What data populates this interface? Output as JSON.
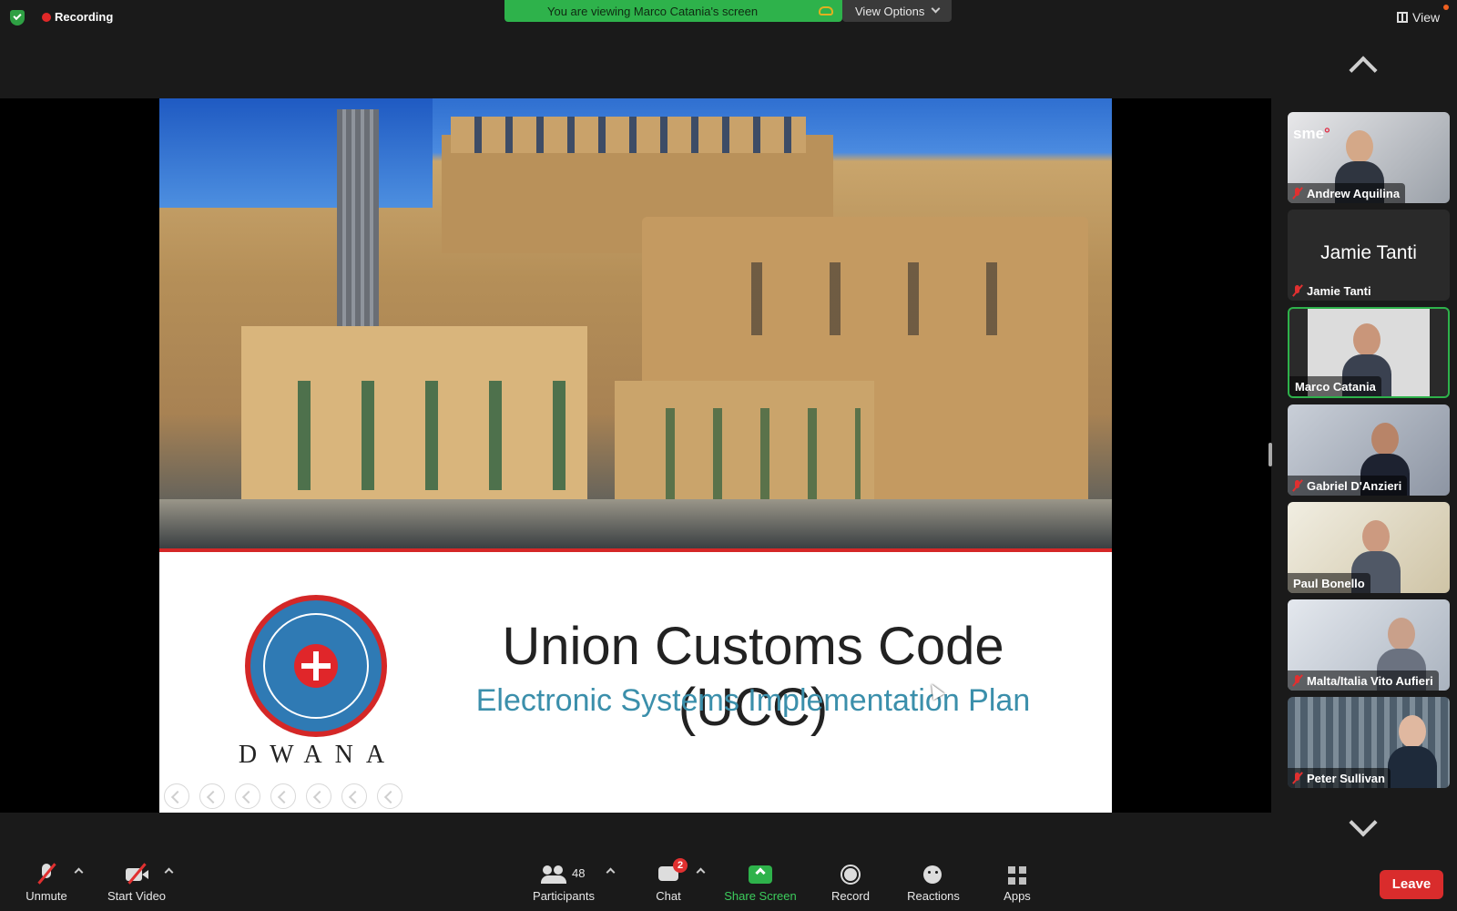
{
  "topbar": {
    "recording_label": "Recording",
    "banner_text": "You are viewing Marco Catania's screen",
    "view_options_label": "View Options",
    "view_label": "View"
  },
  "slide": {
    "title": "Union Customs Code (UCC)",
    "subtitle": "Electronic Systems Implementation Plan",
    "logo_text": "DWANA",
    "logo_icon": "dwana-emblem-icon",
    "controls": [
      "previous-icon",
      "next-icon",
      "pen-icon",
      "slides-icon",
      "zoom-icon",
      "subtitles-icon",
      "more-icon"
    ]
  },
  "gallery": {
    "participants": [
      {
        "name": "Andrew Aquilina",
        "muted": true,
        "video": true,
        "active": false,
        "overlay": "sme"
      },
      {
        "name": "Jamie Tanti",
        "muted": true,
        "video": false,
        "active": false,
        "big_name": "Jamie Tanti"
      },
      {
        "name": "Marco Catania",
        "muted": false,
        "video": true,
        "active": true
      },
      {
        "name": "Gabriel D'Anzieri",
        "muted": true,
        "video": true,
        "active": false
      },
      {
        "name": "Paul Bonello",
        "muted": false,
        "video": true,
        "active": false
      },
      {
        "name": "Malta/Italia Vito Aufieri",
        "muted": true,
        "video": true,
        "active": false
      },
      {
        "name": "Peter Sullivan",
        "muted": true,
        "video": true,
        "active": false
      }
    ]
  },
  "toolbar": {
    "unmute": "Unmute",
    "start_video": "Start Video",
    "participants": "Participants",
    "participants_count": "48",
    "chat": "Chat",
    "chat_badge": "2",
    "share_screen": "Share Screen",
    "record": "Record",
    "reactions": "Reactions",
    "apps": "Apps",
    "leave": "Leave"
  },
  "colors": {
    "accent_green": "#2eb24b",
    "leave_red": "#d92c2c",
    "slide_rule_red": "#d42727",
    "subtitle_teal": "#3b8fab"
  }
}
